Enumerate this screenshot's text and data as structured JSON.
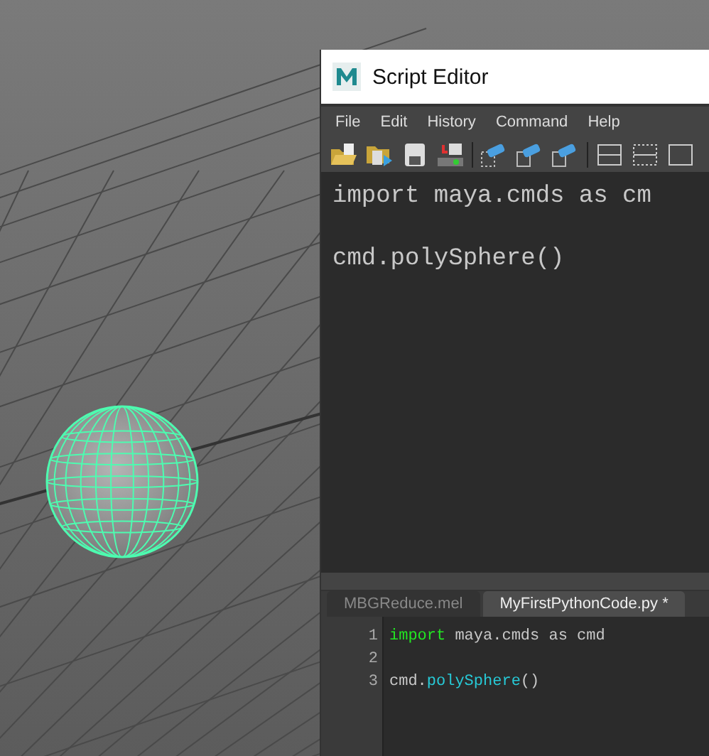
{
  "window": {
    "title": "Script Editor"
  },
  "menu": [
    "File",
    "Edit",
    "History",
    "Command",
    "Help"
  ],
  "history_lines": [
    "import maya.cmds as cm",
    "cmd.polySphere()"
  ],
  "tabs": [
    {
      "label": "MBGReduce.mel",
      "selected": false
    },
    {
      "label": "MyFirstPythonCode.py *",
      "selected": true
    }
  ],
  "code_lines": [
    {
      "number": "1",
      "tokens": [
        {
          "text": "import",
          "kind": "keyword"
        },
        {
          "text": " maya.cmds as cmd",
          "kind": "plain"
        }
      ]
    },
    {
      "number": "2"
    },
    {
      "number": "3",
      "tokens": [
        {
          "text": "cmd.",
          "kind": "plain"
        },
        {
          "text": "polySphere",
          "kind": "function"
        },
        {
          "text": "()",
          "kind": "plain"
        }
      ]
    }
  ]
}
